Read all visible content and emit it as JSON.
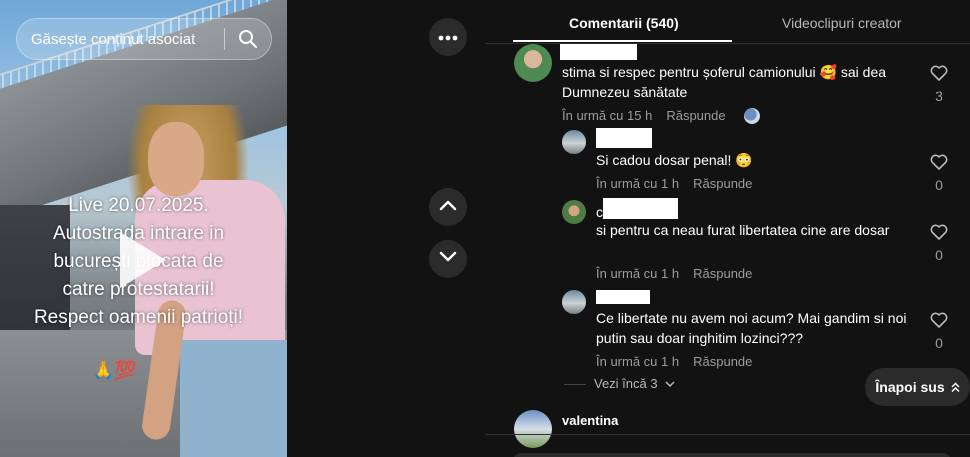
{
  "video": {
    "search_placeholder": "Găsește conținut asociat",
    "overlay_lines": [
      "Live 20.07.2025.",
      "Autostrada intrare in",
      "bucurești blocata de",
      "catre protestatarii!",
      "Respect oamenii patrioți!"
    ],
    "overlay_emoji": "🙏💯"
  },
  "side_controls": {
    "more_icon": "ellipsis-icon",
    "up_icon": "chevron-up-icon",
    "down_icon": "chevron-down-icon"
  },
  "tabs": [
    {
      "label": "Comentarii (540)",
      "active": true
    },
    {
      "label": "Videoclipuri creator",
      "active": false
    }
  ],
  "comments": [
    {
      "text": "stima si respec pentru șoferul camionului 🥰 sai dea Dumnezeu sănătate",
      "time": "În urmă cu 15 h",
      "reply": "Răspunde",
      "likes": "3"
    },
    {
      "text": "Si cadou dosar penal! 😳",
      "time": "În urmă cu 1 h",
      "reply": "Răspunde",
      "likes": "0"
    },
    {
      "name_prefix": "c",
      "text": "si pentru ca neau furat libertatea cine are dosar",
      "time": "În urmă cu 1 h",
      "reply": "Răspunde",
      "likes": "0"
    },
    {
      "text": "Ce libertate nu avem noi acum? Mai gandim si noi putin sau doar inghitim lozinci???",
      "time": "În urmă cu 1 h",
      "reply": "Răspunde",
      "likes": "0"
    }
  ],
  "see_more": "Vezi încă 3",
  "back_to_top": "Înapoi sus",
  "next_comment_name": "valentina",
  "colors": {
    "background": "#121212",
    "muted_text": "#9c9c9c",
    "button_bg": "#2b2b2b"
  }
}
